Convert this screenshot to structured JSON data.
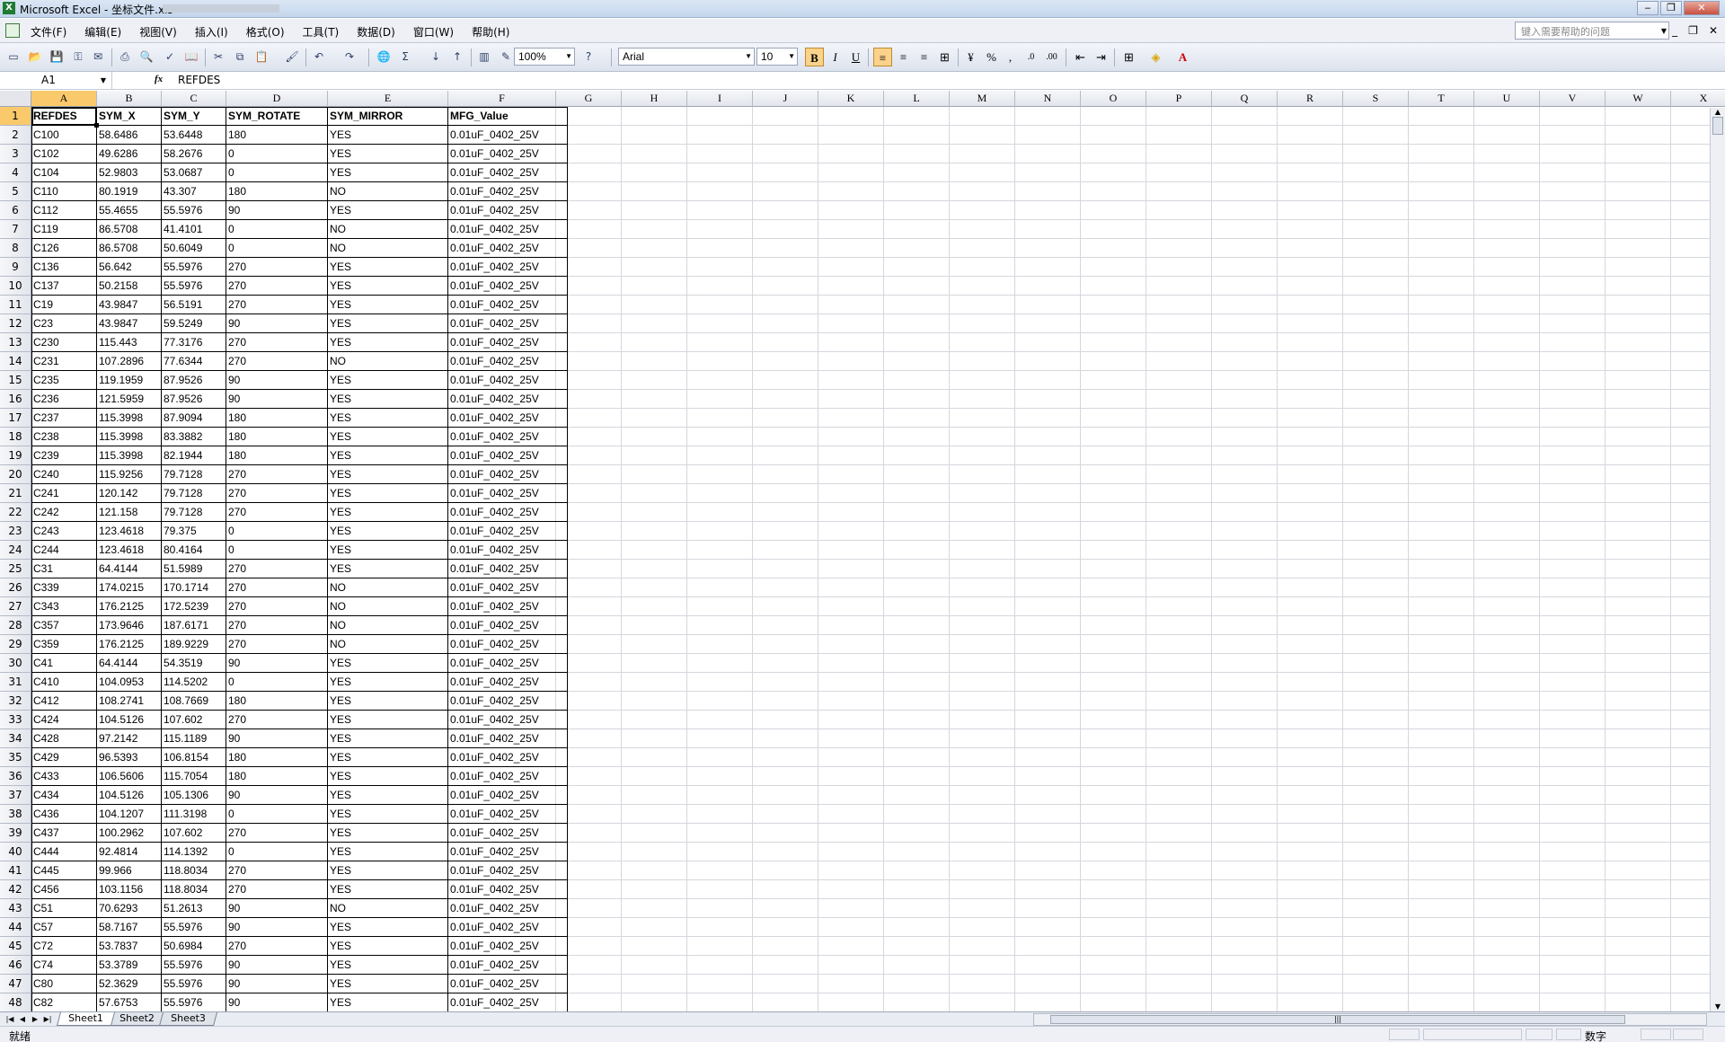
{
  "window": {
    "title": "Microsoft Excel - 坐标文件.xls"
  },
  "menu": [
    "文件(F)",
    "编辑(E)",
    "视图(V)",
    "插入(I)",
    "格式(O)",
    "工具(T)",
    "数据(D)",
    "窗口(W)",
    "帮助(H)"
  ],
  "help_placeholder": "键入需要帮助的问题",
  "toolbar": {
    "zoom": "100%",
    "font": "Arial",
    "font_size": "10",
    "bold_label": "B",
    "italic_label": "I",
    "underline_label": "U",
    "percent_label": "%",
    "comma_label": ","
  },
  "formula": {
    "name_box": "A1",
    "fx": "fx",
    "content": "REFDES"
  },
  "columns": [
    "A",
    "B",
    "C",
    "D",
    "E",
    "F",
    "G",
    "H",
    "I",
    "J",
    "K",
    "L",
    "M",
    "N",
    "O",
    "P",
    "Q",
    "R",
    "S",
    "T",
    "U",
    "V",
    "W",
    "X"
  ],
  "headers": [
    "REFDES",
    "SYM_X",
    "SYM_Y",
    "SYM_ROTATE",
    "SYM_MIRROR",
    "MFG_Value"
  ],
  "rows": [
    [
      "C100",
      "58.6486",
      "53.6448",
      "180",
      "YES",
      "0.01uF_0402_25V"
    ],
    [
      "C102",
      "49.6286",
      "58.2676",
      "0",
      "YES",
      "0.01uF_0402_25V"
    ],
    [
      "C104",
      "52.9803",
      "53.0687",
      "0",
      "YES",
      "0.01uF_0402_25V"
    ],
    [
      "C110",
      "80.1919",
      "43.307",
      "180",
      "NO",
      "0.01uF_0402_25V"
    ],
    [
      "C112",
      "55.4655",
      "55.5976",
      "90",
      "YES",
      "0.01uF_0402_25V"
    ],
    [
      "C119",
      "86.5708",
      "41.4101",
      "0",
      "NO",
      "0.01uF_0402_25V"
    ],
    [
      "C126",
      "86.5708",
      "50.6049",
      "0",
      "NO",
      "0.01uF_0402_25V"
    ],
    [
      "C136",
      "56.642",
      "55.5976",
      "270",
      "YES",
      "0.01uF_0402_25V"
    ],
    [
      "C137",
      "50.2158",
      "55.5976",
      "270",
      "YES",
      "0.01uF_0402_25V"
    ],
    [
      "C19",
      "43.9847",
      "56.5191",
      "270",
      "YES",
      "0.01uF_0402_25V"
    ],
    [
      "C23",
      "43.9847",
      "59.5249",
      "90",
      "YES",
      "0.01uF_0402_25V"
    ],
    [
      "C230",
      "115.443",
      "77.3176",
      "270",
      "YES",
      "0.01uF_0402_25V"
    ],
    [
      "C231",
      "107.2896",
      "77.6344",
      "270",
      "NO",
      "0.01uF_0402_25V"
    ],
    [
      "C235",
      "119.1959",
      "87.9526",
      "90",
      "YES",
      "0.01uF_0402_25V"
    ],
    [
      "C236",
      "121.5959",
      "87.9526",
      "90",
      "YES",
      "0.01uF_0402_25V"
    ],
    [
      "C237",
      "115.3998",
      "87.9094",
      "180",
      "YES",
      "0.01uF_0402_25V"
    ],
    [
      "C238",
      "115.3998",
      "83.3882",
      "180",
      "YES",
      "0.01uF_0402_25V"
    ],
    [
      "C239",
      "115.3998",
      "82.1944",
      "180",
      "YES",
      "0.01uF_0402_25V"
    ],
    [
      "C240",
      "115.9256",
      "79.7128",
      "270",
      "YES",
      "0.01uF_0402_25V"
    ],
    [
      "C241",
      "120.142",
      "79.7128",
      "270",
      "YES",
      "0.01uF_0402_25V"
    ],
    [
      "C242",
      "121.158",
      "79.7128",
      "270",
      "YES",
      "0.01uF_0402_25V"
    ],
    [
      "C243",
      "123.4618",
      "79.375",
      "0",
      "YES",
      "0.01uF_0402_25V"
    ],
    [
      "C244",
      "123.4618",
      "80.4164",
      "0",
      "YES",
      "0.01uF_0402_25V"
    ],
    [
      "C31",
      "64.4144",
      "51.5989",
      "270",
      "YES",
      "0.01uF_0402_25V"
    ],
    [
      "C339",
      "174.0215",
      "170.1714",
      "270",
      "NO",
      "0.01uF_0402_25V"
    ],
    [
      "C343",
      "176.2125",
      "172.5239",
      "270",
      "NO",
      "0.01uF_0402_25V"
    ],
    [
      "C357",
      "173.9646",
      "187.6171",
      "270",
      "NO",
      "0.01uF_0402_25V"
    ],
    [
      "C359",
      "176.2125",
      "189.9229",
      "270",
      "NO",
      "0.01uF_0402_25V"
    ],
    [
      "C41",
      "64.4144",
      "54.3519",
      "90",
      "YES",
      "0.01uF_0402_25V"
    ],
    [
      "C410",
      "104.0953",
      "114.5202",
      "0",
      "YES",
      "0.01uF_0402_25V"
    ],
    [
      "C412",
      "108.2741",
      "108.7669",
      "180",
      "YES",
      "0.01uF_0402_25V"
    ],
    [
      "C424",
      "104.5126",
      "107.602",
      "270",
      "YES",
      "0.01uF_0402_25V"
    ],
    [
      "C428",
      "97.2142",
      "115.1189",
      "90",
      "YES",
      "0.01uF_0402_25V"
    ],
    [
      "C429",
      "96.5393",
      "106.8154",
      "180",
      "YES",
      "0.01uF_0402_25V"
    ],
    [
      "C433",
      "106.5606",
      "115.7054",
      "180",
      "YES",
      "0.01uF_0402_25V"
    ],
    [
      "C434",
      "104.5126",
      "105.1306",
      "90",
      "YES",
      "0.01uF_0402_25V"
    ],
    [
      "C436",
      "104.1207",
      "111.3198",
      "0",
      "YES",
      "0.01uF_0402_25V"
    ],
    [
      "C437",
      "100.2962",
      "107.602",
      "270",
      "YES",
      "0.01uF_0402_25V"
    ],
    [
      "C444",
      "92.4814",
      "114.1392",
      "0",
      "YES",
      "0.01uF_0402_25V"
    ],
    [
      "C445",
      "99.966",
      "118.8034",
      "270",
      "YES",
      "0.01uF_0402_25V"
    ],
    [
      "C456",
      "103.1156",
      "118.8034",
      "270",
      "YES",
      "0.01uF_0402_25V"
    ],
    [
      "C51",
      "70.6293",
      "51.2613",
      "90",
      "NO",
      "0.01uF_0402_25V"
    ],
    [
      "C57",
      "58.7167",
      "55.5976",
      "90",
      "YES",
      "0.01uF_0402_25V"
    ],
    [
      "C72",
      "53.7837",
      "50.6984",
      "270",
      "YES",
      "0.01uF_0402_25V"
    ],
    [
      "C74",
      "53.3789",
      "55.5976",
      "90",
      "YES",
      "0.01uF_0402_25V"
    ],
    [
      "C80",
      "52.3629",
      "55.5976",
      "90",
      "YES",
      "0.01uF_0402_25V"
    ],
    [
      "C82",
      "57.6753",
      "55.5976",
      "90",
      "YES",
      "0.01uF_0402_25V"
    ]
  ],
  "sheets": [
    "Sheet1",
    "Sheet2",
    "Sheet3"
  ],
  "status": {
    "ready": "就绪",
    "mode": "数字"
  }
}
